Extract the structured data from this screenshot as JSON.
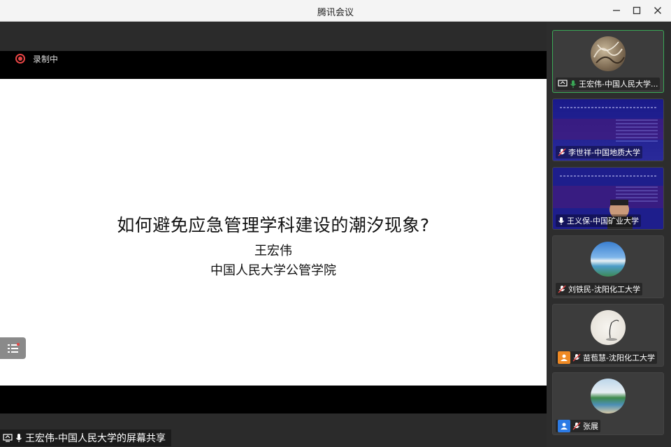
{
  "window": {
    "title": "腾讯会议",
    "minimize_icon": "minimize-icon",
    "maximize_icon": "maximize-icon",
    "close_icon": "close-icon"
  },
  "recording": {
    "label": "录制中",
    "color": "#e84545"
  },
  "slide": {
    "title": "如何避免应急管理学科建设的潮汐现象?",
    "author": "王宏伟",
    "organization": "中国人民大学公管学院"
  },
  "share_label": {
    "text": "王宏伟-中国人民大学的屏幕共享"
  },
  "participants": [
    {
      "name": "王宏伟-中国人民大学...",
      "mic": "active",
      "badge": "screen-share",
      "active": true
    },
    {
      "name": "李世祥-中国地质大学",
      "mic": "muted",
      "badge": "",
      "active": false
    },
    {
      "name": "王义保-中国矿业大学",
      "mic": "on",
      "badge": "",
      "active": false
    },
    {
      "name": "刘铁民-沈阳化工大学",
      "mic": "muted",
      "badge": "",
      "active": false
    },
    {
      "name": "苗苞慧-沈阳化工大学",
      "mic": "muted",
      "badge": "user-orange",
      "active": false
    },
    {
      "name": "张展",
      "mic": "muted",
      "badge": "user-blue",
      "active": false
    }
  ],
  "colors": {
    "active_border": "#3aa856",
    "mic_active": "#3aa856",
    "badge_orange": "#f08a24",
    "badge_blue": "#2c7be5"
  }
}
